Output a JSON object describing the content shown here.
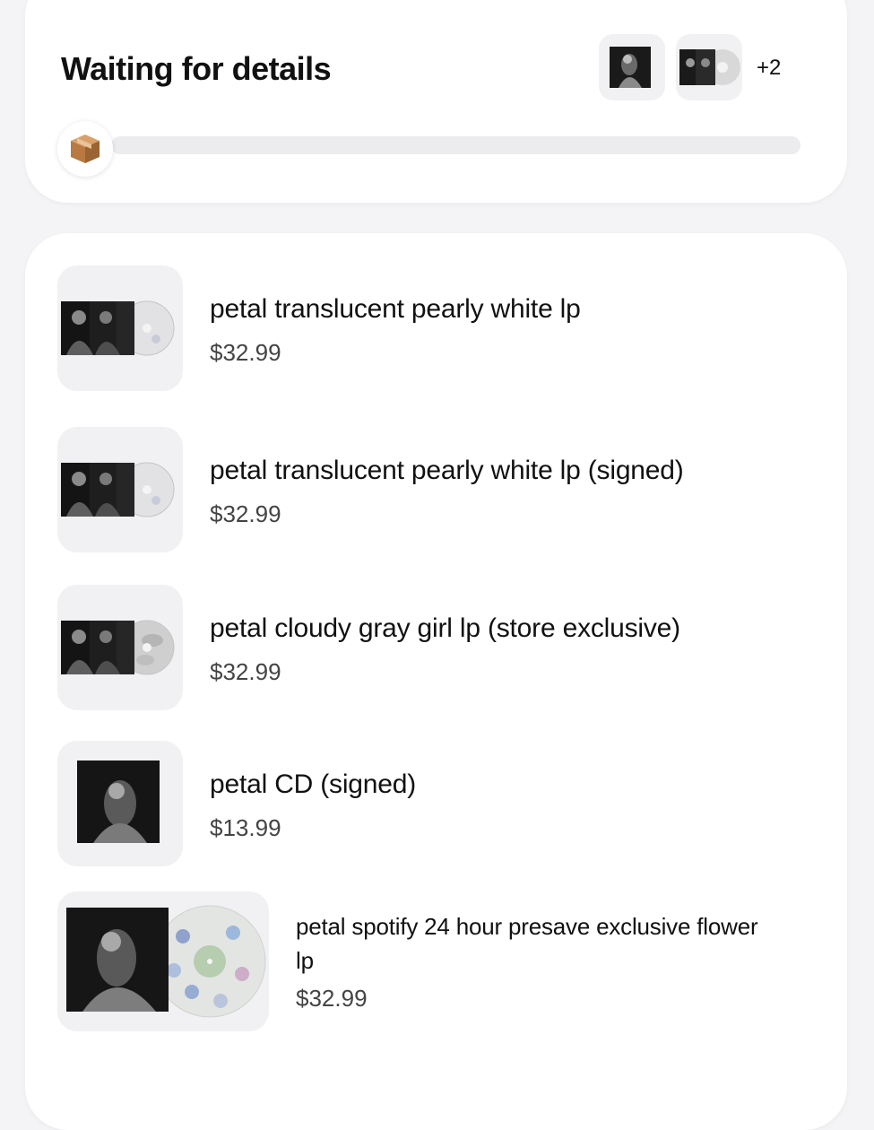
{
  "status": {
    "title": "Waiting for details",
    "more_count": "+2",
    "progress": 0.0
  },
  "items": [
    {
      "name": "petal translucent pearly white lp",
      "price": "$32.99",
      "disc": "pearly"
    },
    {
      "name": "petal translucent pearly white lp (signed)",
      "price": "$32.99",
      "disc": "pearly"
    },
    {
      "name": "petal cloudy gray girl lp (store exclusive)",
      "price": "$32.99",
      "disc": "cloudy"
    },
    {
      "name": "petal CD (signed)",
      "price": "$13.99",
      "disc": "none"
    },
    {
      "name": "petal spotify 24 hour presave exclusive flower lp",
      "price": "$32.99",
      "disc": "flower"
    }
  ],
  "colors": {
    "background": "#f4f4f6",
    "card": "#ffffff",
    "thumb_bg": "#f1f1f3",
    "text": "#111111",
    "price": "#444444"
  }
}
